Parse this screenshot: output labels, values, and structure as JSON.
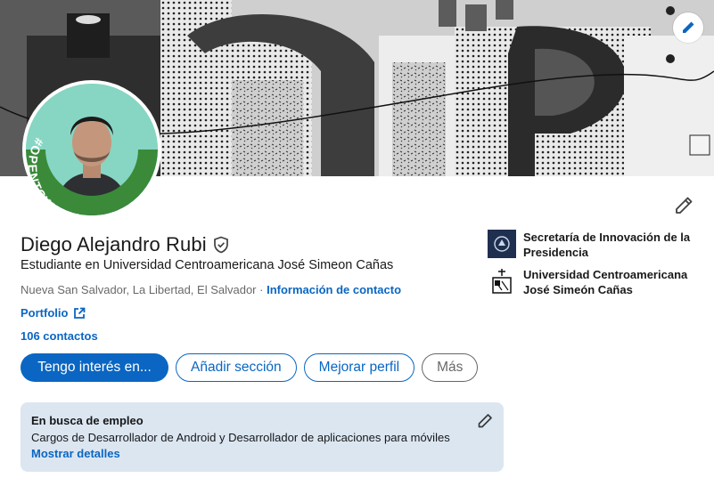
{
  "profile": {
    "name": "Diego Alejandro Rubi",
    "headline": "Estudiante en Universidad Centroamericana José Simeon Cañas",
    "location": "Nueva San Salvador, La Libertad, El Salvador",
    "location_separator": " · ",
    "contact_info_label": "Información de contacto",
    "portfolio_label": "Portfolio",
    "contacts_label": "106 contactos",
    "open_to_work_badge": "#OPENTOWORK"
  },
  "actions": {
    "open_to": "Tengo interés en...",
    "add_section": "Añadir sección",
    "improve_profile": "Mejorar perfil",
    "more": "Más"
  },
  "experience": [
    {
      "label": "Secretaría de Innovación de la Presidencia"
    },
    {
      "label": "Universidad Centroamericana José Simeón Cañas"
    }
  ],
  "open_to_work": {
    "title": "En busca de empleo",
    "roles": "Cargos de Desarrollador de Android y Desarrollador de aplicaciones para móviles",
    "show_details": "Mostrar detalles"
  },
  "colors": {
    "primary": "#0a66c2",
    "open_to_work_green": "#3a8a3a",
    "card_bg": "#dce6f1"
  }
}
